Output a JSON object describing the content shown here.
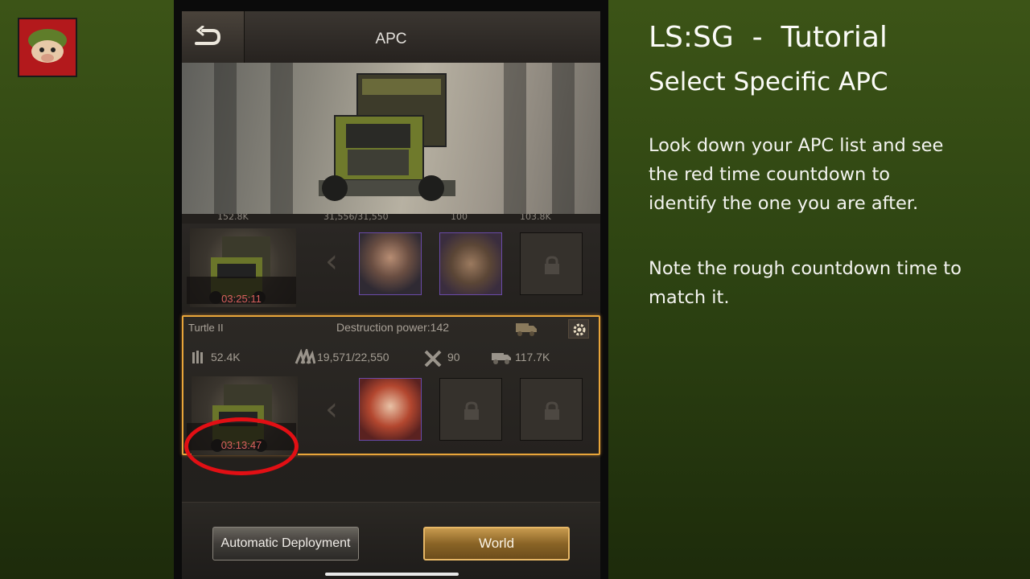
{
  "channel_logo": {
    "icon": "soldier-helmet-avatar-icon",
    "bg_color": "#b3191c"
  },
  "app": {
    "title": "APC",
    "back_icon": "back-arrow-icon"
  },
  "peek_row_stats": [
    "152.8K",
    "31,556/31,550",
    "100",
    "103.8K"
  ],
  "apc_rows": [
    {
      "timer": "03:25:11",
      "heroes": [
        "hero-scarred-male",
        "hero-cowboy-hat"
      ],
      "locked_slots": 1
    },
    {
      "name": "Turtle II",
      "destruction_power": "Destruction power:142",
      "stats": {
        "ammo": "52.4K",
        "capacity": "19,571/22,550",
        "repair": "90",
        "load": "117.7K"
      },
      "timer": "03:13:47",
      "heroes": [
        "hero-red-haired-female"
      ],
      "locked_slots": 2,
      "selected": true
    }
  ],
  "buttons": {
    "auto_deploy": "Automatic Deployment",
    "world": "World"
  },
  "tutorial": {
    "heading": "LS:SG  -  Tutorial",
    "subheading": "Select Specific APC",
    "paragraph1": [
      "Look down your APC list and see",
      "the red time countdown to",
      "identify the one you are after."
    ],
    "paragraph2": [
      "Note the rough countdown time to",
      "match it."
    ]
  },
  "colors": {
    "highlight_border": "#e8a53a",
    "timer_red": "#d8605d",
    "annotation_circle": "#e20f14",
    "world_button": "#a67a34"
  }
}
